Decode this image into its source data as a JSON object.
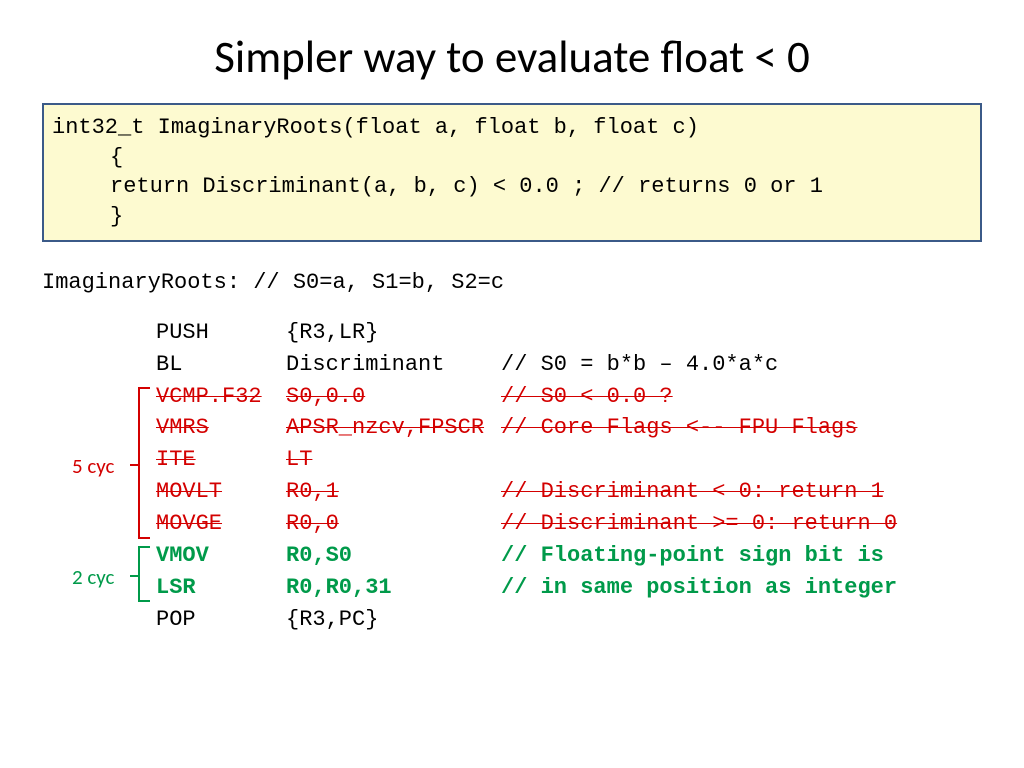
{
  "title": "Simpler way to evaluate float < 0",
  "code": {
    "l1": "int32_t ImaginaryRoots(float a, float b, float c)",
    "l2": "{",
    "l3": "return Discriminant(a, b, c) < 0.0 ;  // returns 0 or 1",
    "l4": "}"
  },
  "asm_header": "ImaginaryRoots: // S0=a, S1=b, S2=c",
  "asm": [
    {
      "op": "PUSH",
      "args": "{R3,LR}",
      "cmt": "",
      "cls": "c-black"
    },
    {
      "op": "BL",
      "args": "Discriminant",
      "cmt": "// S0 = b*b – 4.0*a*c",
      "cls": "c-black"
    },
    {
      "op": "VCMP.F32",
      "args": "S0,0.0",
      "cmt": "// S0 < 0.0 ?",
      "cls": "c-red"
    },
    {
      "op": "VMRS",
      "args": "APSR_nzcv,FPSCR",
      "cmt": "// Core Flags <-- FPU Flags",
      "cls": "c-red"
    },
    {
      "op": "ITE",
      "args": "LT",
      "cmt": "",
      "cls": "c-red"
    },
    {
      "op": "MOVLT",
      "args": "R0,1",
      "cmt": "// Discriminant < 0:  return 1",
      "cls": "c-red"
    },
    {
      "op": "MOVGE",
      "args": "R0,0",
      "cmt": "// Discriminant >= 0: return 0",
      "cls": "c-red"
    },
    {
      "op": "VMOV",
      "args": "R0,S0",
      "cmt": "// Floating-point sign bit is",
      "cls": "c-green"
    },
    {
      "op": "LSR",
      "args": "R0,R0,31",
      "cmt": "// in same position as integer",
      "cls": "c-green"
    },
    {
      "op": "POP",
      "args": "{R3,PC}",
      "cmt": "",
      "cls": "c-black"
    }
  ],
  "annotations": {
    "red_label": "5 cyc",
    "green_label": "2 cyc"
  }
}
